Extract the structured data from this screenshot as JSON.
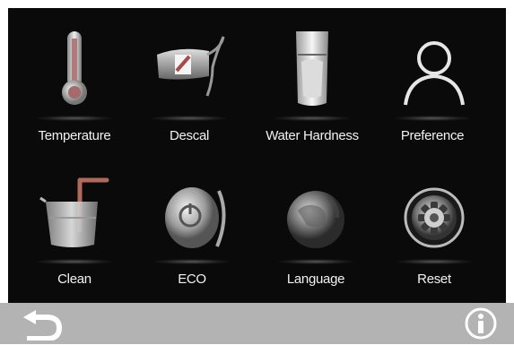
{
  "menu": {
    "items": [
      {
        "label": "Temperature",
        "icon": "thermometer-icon"
      },
      {
        "label": "Descal",
        "icon": "descale-icon"
      },
      {
        "label": "Water Hardness",
        "icon": "water-glass-icon"
      },
      {
        "label": "Preference",
        "icon": "user-icon"
      },
      {
        "label": "Clean",
        "icon": "clean-icon"
      },
      {
        "label": "ECO",
        "icon": "eco-power-icon"
      },
      {
        "label": "Language",
        "icon": "globe-icon"
      },
      {
        "label": "Reset",
        "icon": "reset-gear-icon"
      }
    ]
  },
  "bottom_bar": {
    "back_icon": "back-arrow-icon",
    "info_icon": "info-icon"
  },
  "colors": {
    "screen_bg": "#0a0a0a",
    "bar_bg": "#b3b3b3",
    "label": "#f2f2f2"
  }
}
